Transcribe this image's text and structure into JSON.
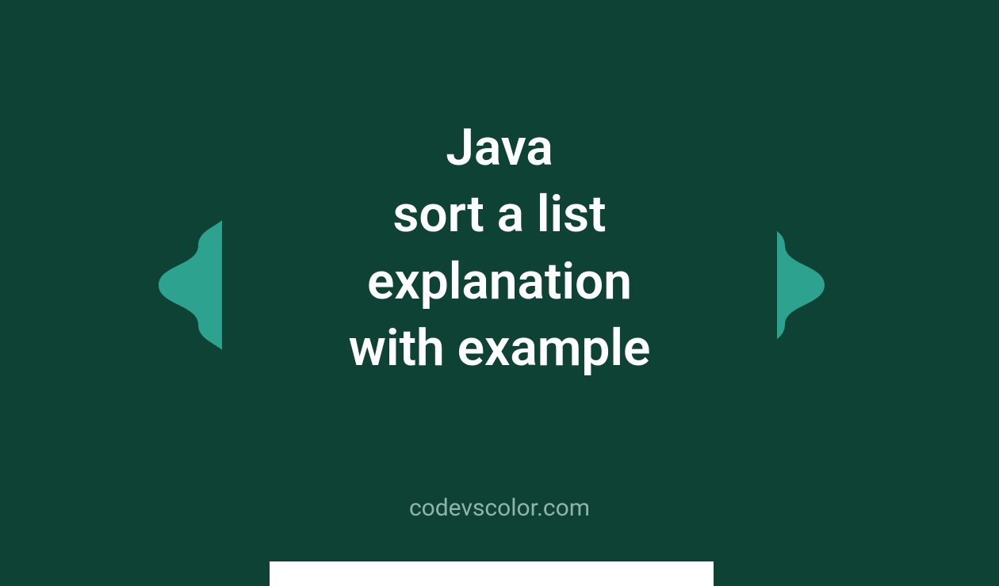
{
  "title": {
    "line1": "Java",
    "line2": "sort a list",
    "line3": "explanation",
    "line4": "with example"
  },
  "attribution": "codevscolor.com",
  "colors": {
    "background_light": "#2ca28f",
    "background_dark": "#0e4235",
    "text_main": "#ffffff",
    "text_attribution": "#8fb5ab"
  }
}
